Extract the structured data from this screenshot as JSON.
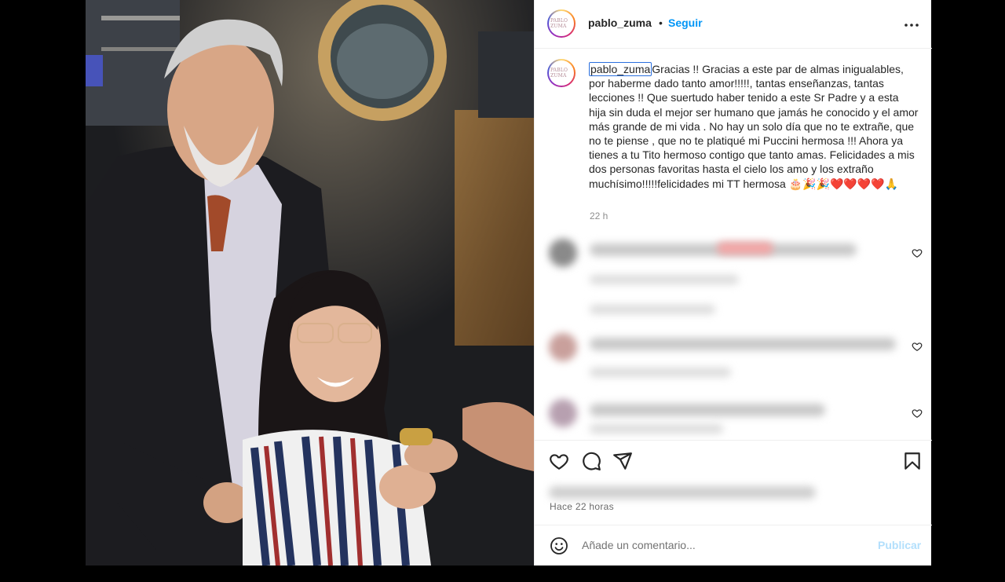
{
  "post": {
    "username": "pablo_zuma",
    "separator": "•",
    "follow_label": "Seguir",
    "avatar_text": "PABLO ZUMA",
    "caption_user": "pablo_zuma",
    "caption_text": "Gracias !! Gracias a este par de almas inigualables, por haberme dado tanto amor!!!!!, tantas enseñanzas, tantas lecciones !! Que suertudo haber tenido a este Sr Padre y a esta hija sin duda el mejor ser humano que jamás he conocido y el amor más grande de mi vida . No hay un solo día que no te extrañe, que no te piense , que no te platiqué mi Puccini hermosa !!! Ahora ya tienes a tu Tito hermoso contigo que tanto amas. Felicidades a mis dos personas favoritas hasta el cielo los amo y los extraño muchísimo!!!!!felicidades mi TT hermosa 🎂🎉🎉❤️❤️❤️❤️🙏",
    "caption_time": "22 h",
    "posted_time": "Hace 22 horas"
  },
  "comment_box": {
    "placeholder": "Añade un comentario...",
    "publish_label": "Publicar"
  },
  "icons": {
    "more": "more-icon",
    "like": "heart-icon",
    "comment": "comment-icon",
    "share": "send-icon",
    "save": "bookmark-icon",
    "emoji": "emoji-icon"
  },
  "colors": {
    "accent": "#0095f6",
    "publish_disabled": "#b2dffc",
    "text": "#262626",
    "muted": "#8e8e8e"
  }
}
